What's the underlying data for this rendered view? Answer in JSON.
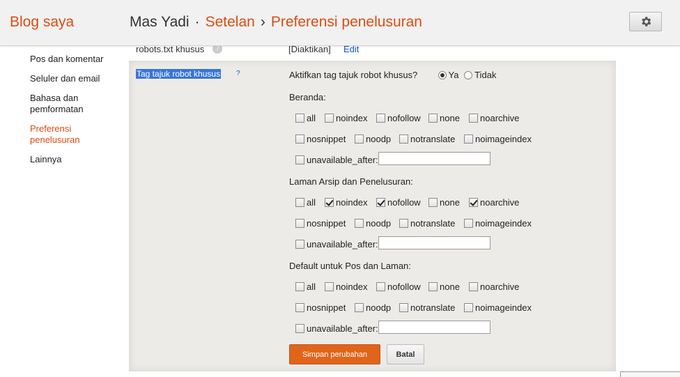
{
  "header": {
    "logo": "Blog saya",
    "user": "Mas Yadi",
    "dot": "·",
    "arrow": "›",
    "crumb_settings": "Setelan",
    "crumb_page": "Preferensi penelusuran",
    "gear_icon": "gear-icon"
  },
  "sidebar": {
    "items": [
      {
        "label": "Pos dan komentar"
      },
      {
        "label": "Seluler dan email"
      },
      {
        "label": "Bahasa dan pemformatan"
      },
      {
        "label": "Preferensi penelusuran"
      },
      {
        "label": "Lainnya"
      }
    ]
  },
  "robots_txt": {
    "label": "robots.txt khusus",
    "help": "?",
    "value": "[Diaktikan]",
    "edit": "Edit"
  },
  "robot_tags": {
    "label": "Tag tajuk robot khusus",
    "help": "?",
    "enable_question": "Aktifkan tag tajuk robot khusus?",
    "yes_label": "Ya",
    "no_label": "Tidak",
    "sections": [
      {
        "title": "Beranda:",
        "options": [
          {
            "label": "all",
            "checked": false
          },
          {
            "label": "noindex",
            "checked": false
          },
          {
            "label": "nofollow",
            "checked": false
          },
          {
            "label": "none",
            "checked": false
          },
          {
            "label": "noarchive",
            "checked": false
          },
          {
            "label": "nosnippet",
            "checked": false
          },
          {
            "label": "noodp",
            "checked": false
          },
          {
            "label": "notranslate",
            "checked": false
          },
          {
            "label": "noimageindex",
            "checked": false
          },
          {
            "label": "unavailable_after:",
            "checked": false
          }
        ]
      },
      {
        "title": "Laman Arsip dan Penelusuran:",
        "options": [
          {
            "label": "all",
            "checked": false
          },
          {
            "label": "noindex",
            "checked": true
          },
          {
            "label": "nofollow",
            "checked": true
          },
          {
            "label": "none",
            "checked": false
          },
          {
            "label": "noarchive",
            "checked": true
          },
          {
            "label": "nosnippet",
            "checked": false
          },
          {
            "label": "noodp",
            "checked": false
          },
          {
            "label": "notranslate",
            "checked": false
          },
          {
            "label": "noimageindex",
            "checked": false
          },
          {
            "label": "unavailable_after:",
            "checked": false
          }
        ]
      },
      {
        "title": "Default untuk Pos dan Laman:",
        "options": [
          {
            "label": "all",
            "checked": false
          },
          {
            "label": "noindex",
            "checked": false
          },
          {
            "label": "nofollow",
            "checked": false
          },
          {
            "label": "none",
            "checked": false
          },
          {
            "label": "noarchive",
            "checked": false
          },
          {
            "label": "nosnippet",
            "checked": false
          },
          {
            "label": "noodp",
            "checked": false
          },
          {
            "label": "notranslate",
            "checked": false
          },
          {
            "label": "noimageindex",
            "checked": false
          },
          {
            "label": "unavailable_after:",
            "checked": false
          }
        ]
      }
    ],
    "save_label": "Simpan perubahan",
    "cancel_label": "Batal"
  },
  "colors": {
    "accent": "#dd4b11",
    "save_button": "#e0651b",
    "link": "#1155cc",
    "panel_bg": "#edebe7",
    "selection": "#3875d7"
  }
}
